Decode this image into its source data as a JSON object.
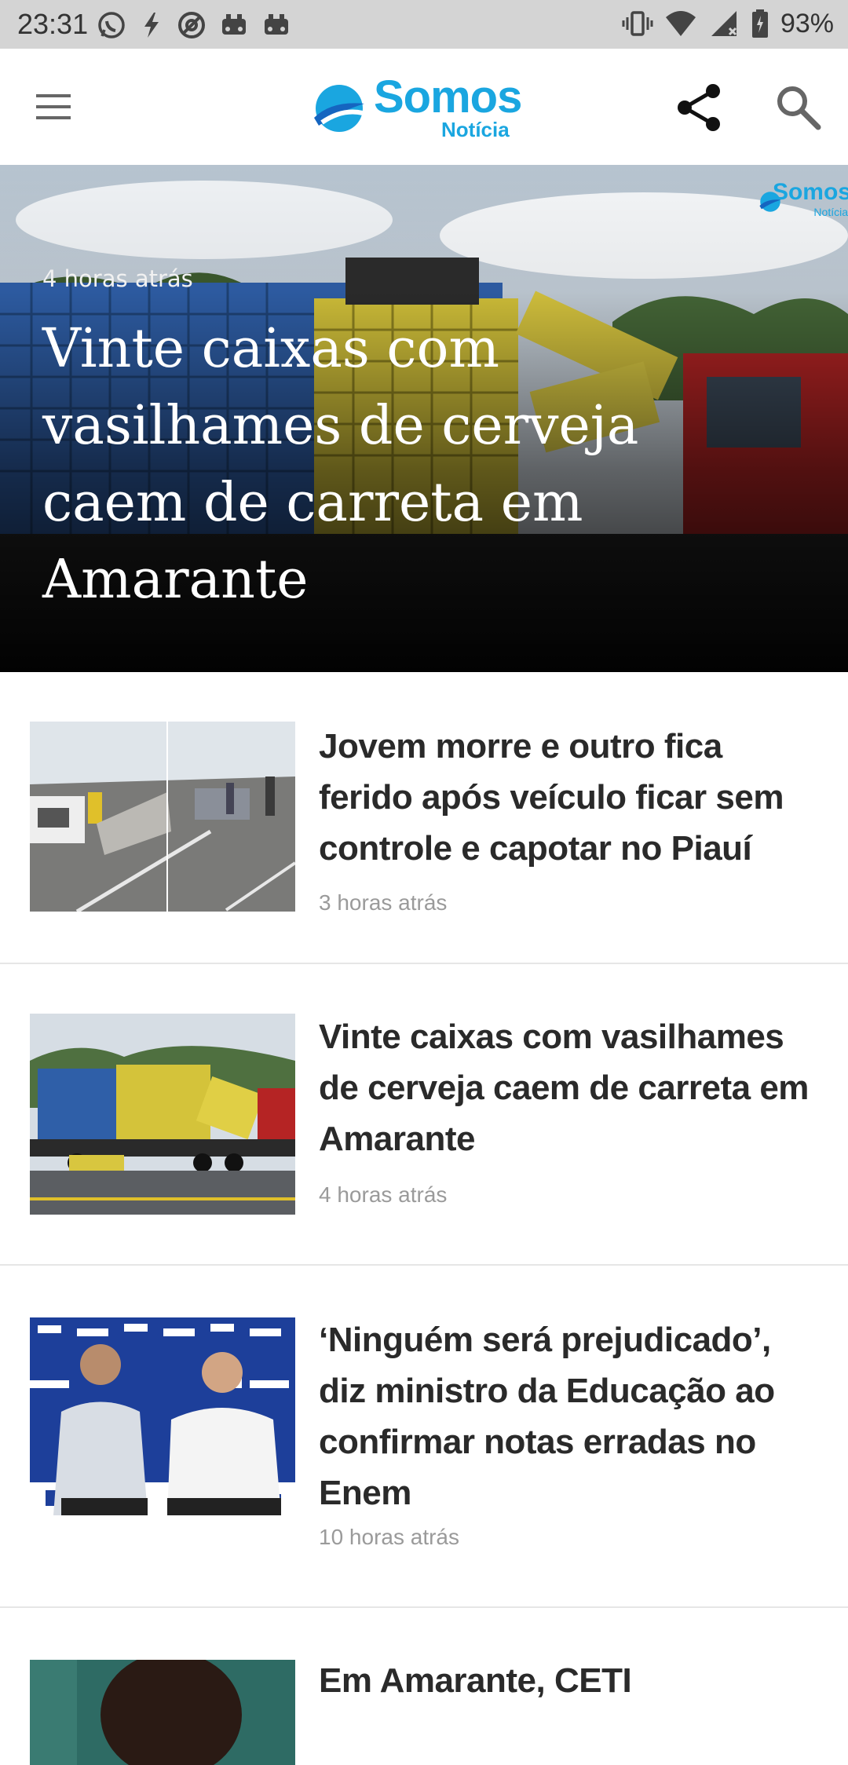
{
  "status_bar": {
    "time": "23:31",
    "battery": "93%",
    "icons": [
      "whatsapp-icon",
      "flash-icon",
      "at-icon",
      "car-icon",
      "car-icon",
      "vibrate-icon",
      "wifi-icon",
      "signal-icon",
      "battery-icon"
    ]
  },
  "app_bar": {
    "logo_brand": "Somos",
    "logo_sub": "Notícia",
    "icons": [
      "menu-icon",
      "share-icon",
      "search-icon"
    ]
  },
  "hero": {
    "time": "4 horas atrás",
    "title": "Vinte caixas com vasilhames de cerveja caem de carreta em Amarante",
    "watermark_brand": "Somos",
    "watermark_sub": "Notícia"
  },
  "articles": [
    {
      "title": "Jovem morre e outro fica ferido após veículo ficar sem controle e capotar no Piauí",
      "time": "3 horas atrás"
    },
    {
      "title": "Vinte caixas com vasilhames de cerveja caem de carreta em Amarante",
      "time": "4 horas atrás"
    },
    {
      "title": "‘Ninguém será prejudicado’, diz ministro da Educação ao confirmar notas erradas no Enem",
      "time": "10 horas atrás"
    },
    {
      "title": "Em Amarante, CETI",
      "time": ""
    }
  ],
  "colors": {
    "brand_blue": "#1aa6e0",
    "brand_dark_blue": "#1565c0",
    "status_bar": "#d4d4d4",
    "title_text": "#2a2a2a",
    "meta_text": "#9a9a9a"
  }
}
